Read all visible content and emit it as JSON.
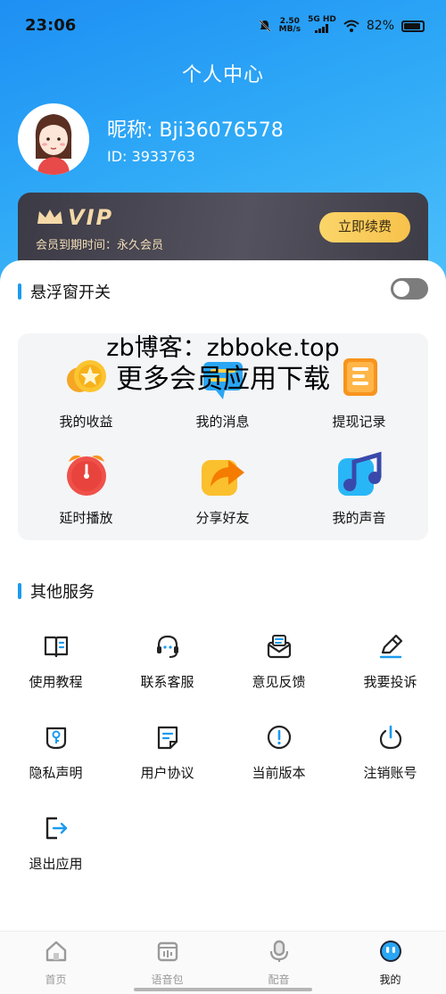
{
  "status_bar": {
    "time": "23:06",
    "speed_value": "2.50",
    "speed_unit": "MB/s",
    "network": "5G HD",
    "battery": "82%"
  },
  "header": {
    "title": "个人中心"
  },
  "profile": {
    "nickname": "昵称: Bji36076578",
    "id": "ID: 3933763",
    "avatar_icon": "girl-avatar"
  },
  "vip": {
    "badge": "VIP",
    "expire_text": "会员到期时间：永久会员",
    "renew_label": "立即续费"
  },
  "floating_window": {
    "title": "悬浮窗开关",
    "enabled": false
  },
  "watermark": {
    "line1": "zb博客：zbboke.top",
    "line2": "更多会员应用下载"
  },
  "features": [
    {
      "label": "我的收益",
      "icon": "coins-icon"
    },
    {
      "label": "我的消息",
      "icon": "message-icon"
    },
    {
      "label": "提现记录",
      "icon": "record-icon"
    },
    {
      "label": "延时播放",
      "icon": "alarm-clock-icon"
    },
    {
      "label": "分享好友",
      "icon": "share-icon"
    },
    {
      "label": "我的声音",
      "icon": "music-note-icon"
    }
  ],
  "other_services": {
    "title": "其他服务",
    "items": [
      {
        "label": "使用教程",
        "icon": "book-icon"
      },
      {
        "label": "联系客服",
        "icon": "headset-icon"
      },
      {
        "label": "意见反馈",
        "icon": "feedback-mail-icon"
      },
      {
        "label": "我要投诉",
        "icon": "pen-icon"
      },
      {
        "label": "隐私声明",
        "icon": "key-shield-icon"
      },
      {
        "label": "用户协议",
        "icon": "document-icon"
      },
      {
        "label": "当前版本",
        "icon": "info-circle-icon"
      },
      {
        "label": "注销账号",
        "icon": "power-icon"
      },
      {
        "label": "退出应用",
        "icon": "logout-icon"
      }
    ]
  },
  "tabbar": {
    "items": [
      {
        "label": "首页",
        "icon": "home-icon",
        "active": false
      },
      {
        "label": "语音包",
        "icon": "voice-pack-icon",
        "active": false
      },
      {
        "label": "配音",
        "icon": "microphone-icon",
        "active": false
      },
      {
        "label": "我的",
        "icon": "profile-face-icon",
        "active": true
      }
    ]
  },
  "colors": {
    "brand_blue": "#1e8ff4",
    "accent_bar": "#1a9bf0",
    "vip_gold": "#f7c24c",
    "vip_card": "#3b3a45"
  }
}
